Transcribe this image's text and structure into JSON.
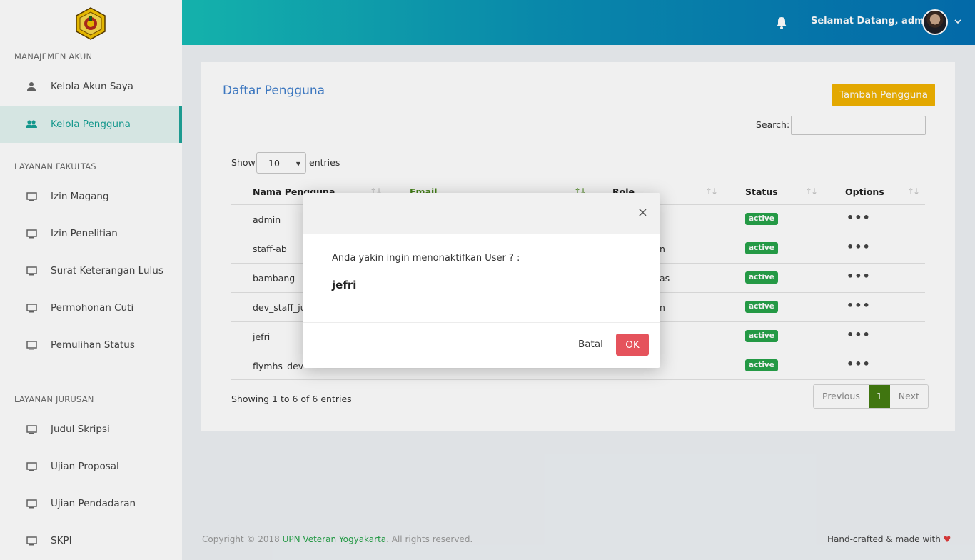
{
  "sidebar": {
    "logo_icon": "university-seal-icon",
    "sections": [
      {
        "title": "MANAJEMEN AKUN"
      },
      {
        "title": "LAYANAN FAKULTAS"
      },
      {
        "title": "LAYANAN JURUSAN"
      }
    ],
    "account_items": [
      {
        "label": "Kelola Akun Saya",
        "icon": "person-icon"
      },
      {
        "label": "Kelola Pengguna",
        "icon": "people-icon",
        "active": true
      }
    ],
    "faculty_items": [
      {
        "label": "Izin Magang",
        "icon": "monitor-icon"
      },
      {
        "label": "Izin Penelitian",
        "icon": "monitor-icon"
      },
      {
        "label": "Surat Keterangan Lulus",
        "icon": "monitor-icon"
      },
      {
        "label": "Permohonan Cuti",
        "icon": "monitor-icon"
      },
      {
        "label": "Pemulihan Status",
        "icon": "monitor-icon"
      }
    ],
    "department_items": [
      {
        "label": "Judul Skripsi",
        "icon": "monitor-icon"
      },
      {
        "label": "Ujian Proposal",
        "icon": "monitor-icon"
      },
      {
        "label": "Ujian Pendadaran",
        "icon": "monitor-icon"
      },
      {
        "label": "SKPI",
        "icon": "monitor-icon"
      }
    ],
    "active_color": "#1fa49a"
  },
  "header": {
    "welcome": "Selamat Datang, admin",
    "bell_icon": "bell-icon",
    "gradient": [
      "#16bdb6",
      "#0470b3"
    ]
  },
  "card": {
    "title": "Daftar Pengguna",
    "add_button": "Tambah Pengguna",
    "search_label": "Search:",
    "search_value": "",
    "show_label": "Show",
    "show_value": "10",
    "entries_label": "entries",
    "columns": [
      "Nama Pengguna",
      "Email",
      "Role",
      "Status",
      "Options"
    ],
    "rows": [
      {
        "name": "admin",
        "email": "",
        "role": "",
        "status": "active"
      },
      {
        "name": "staff-ab",
        "email": "",
        "role": "n",
        "status": "active"
      },
      {
        "name": "bambang",
        "email": "",
        "role": "as",
        "status": "active"
      },
      {
        "name": "dev_staff_ju",
        "email": "",
        "role": "n",
        "status": "active"
      },
      {
        "name": "jefri",
        "email": "",
        "role": "",
        "status": "active"
      },
      {
        "name": "flymhs_dev",
        "email": "",
        "role": "",
        "status": "active"
      }
    ],
    "showing": "Showing 1 to 6 of 6 entries",
    "pagination": {
      "previous": "Previous",
      "current": "1",
      "next": "Next"
    }
  },
  "footer": {
    "copyright_prefix": "Copyright © 2018 ",
    "brand": "UPN Veteran Yogyakarta",
    "copyright_suffix": ". All rights reserved.",
    "right": "Hand-crafted & made with"
  },
  "modal": {
    "close": "×",
    "message": "Anda yakin ingin menonaktifkan User ? :",
    "user": "jefri",
    "cancel": "Batal",
    "ok": "OK"
  },
  "colors": {
    "add_button": "#f2b300",
    "badge_active": "#27a34a",
    "ok_button": "#e5535c",
    "title": "#3f7ecb"
  }
}
